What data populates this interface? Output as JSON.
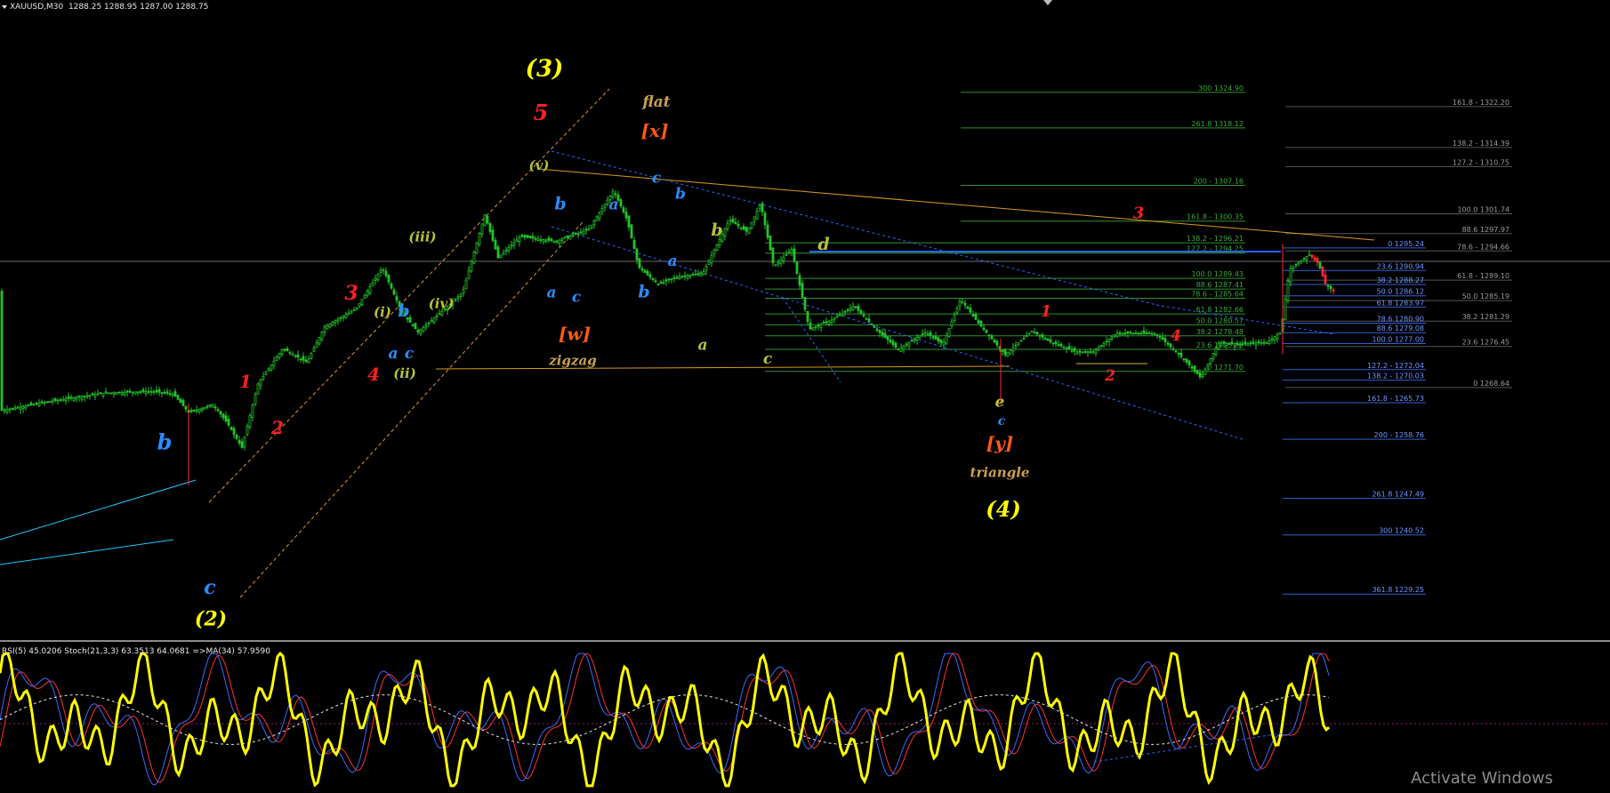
{
  "header": {
    "symbol": "XAUUSD,M30",
    "ohlc": "1288.25 1288.95 1287.00 1288.75"
  },
  "oscillator_header": "RSI(5) 45.0206  Stoch(21,3,3) 63.3513 64.0681  =>MA(34) 57.9590",
  "watermark": "Activate Windows",
  "colors": {
    "background": "#000000",
    "candle": "#22c22a",
    "candle_bear": "#ff2a2a",
    "fib_green": "#2f8f2f",
    "fib_blue": "#2f5fd0",
    "trendline_orange": "#d99a1b",
    "trendline_blue": "#2a63ff",
    "rsi": "#ffff00"
  },
  "chart_data": [
    {
      "type": "candlestick",
      "title": "XAUUSD,M30",
      "ylim": [
        1222,
        1334
      ],
      "price_path": [
        [
          0,
          1264.2
        ],
        [
          60,
          1266.1
        ],
        [
          120,
          1267.6
        ],
        [
          170,
          1267.9
        ],
        [
          195,
          1267.4
        ],
        [
          212,
          1263.9
        ],
        [
          240,
          1265.3
        ],
        [
          255,
          1262.0
        ],
        [
          272,
          1257.2
        ],
        [
          290,
          1269.3
        ],
        [
          318,
          1276.1
        ],
        [
          345,
          1273.4
        ],
        [
          365,
          1280.2
        ],
        [
          400,
          1283.6
        ],
        [
          430,
          1291.5
        ],
        [
          452,
          1282.9
        ],
        [
          470,
          1279.2
        ],
        [
          500,
          1283.6
        ],
        [
          520,
          1286.7
        ],
        [
          545,
          1301.6
        ],
        [
          560,
          1293.4
        ],
        [
          585,
          1297.4
        ],
        [
          625,
          1296.5
        ],
        [
          662,
          1298.8
        ],
        [
          690,
          1306.2
        ],
        [
          705,
          1300.6
        ],
        [
          718,
          1291.6
        ],
        [
          740,
          1288.3
        ],
        [
          760,
          1289.7
        ],
        [
          790,
          1290.4
        ],
        [
          820,
          1300.6
        ],
        [
          840,
          1298.3
        ],
        [
          855,
          1303.7
        ],
        [
          870,
          1291.6
        ],
        [
          890,
          1295.0
        ],
        [
          910,
          1279.7
        ],
        [
          935,
          1281.5
        ],
        [
          960,
          1284.2
        ],
        [
          985,
          1279.7
        ],
        [
          1010,
          1275.9
        ],
        [
          1040,
          1279.2
        ],
        [
          1060,
          1276.9
        ],
        [
          1080,
          1285.5
        ],
        [
          1100,
          1280.9
        ],
        [
          1130,
          1274.9
        ],
        [
          1160,
          1279.4
        ],
        [
          1180,
          1277.4
        ],
        [
          1210,
          1275.4
        ],
        [
          1230,
          1275.5
        ],
        [
          1255,
          1279.0
        ],
        [
          1280,
          1279.0
        ],
        [
          1300,
          1278.9
        ],
        [
          1330,
          1274.2
        ],
        [
          1350,
          1270.5
        ],
        [
          1370,
          1277.1
        ],
        [
          1400,
          1276.9
        ],
        [
          1425,
          1277.3
        ],
        [
          1440,
          1279.2
        ],
        [
          1445,
          1285.5
        ],
        [
          1450,
          1291.2
        ],
        [
          1460,
          1292.5
        ],
        [
          1472,
          1294.0
        ],
        [
          1482,
          1292.3
        ],
        [
          1490,
          1288.5
        ],
        [
          1500,
          1286.8
        ],
        [
          1502,
          1287.0
        ]
      ],
      "fib_levels_upper": [
        {
          "label": "300 1324.90",
          "price": 1324.9
        },
        {
          "label": "261.8 1318.12",
          "price": 1318.12
        },
        {
          "label": "200 - 1307.16",
          "price": 1307.16
        },
        {
          "label": "161.8 - 1300.35",
          "price": 1300.35
        },
        {
          "label": "138.2 - 1296.21",
          "price": 1296.21
        },
        {
          "label": "127.2 - 1294.25",
          "price": 1294.25
        },
        {
          "label": "100.0 1289.43",
          "price": 1289.43
        },
        {
          "label": "88.6 1287.41",
          "price": 1287.41
        },
        {
          "label": "78.6 - 1285.64",
          "price": 1285.64
        },
        {
          "label": "61.8 1282.66",
          "price": 1282.66
        },
        {
          "label": "50.0 1280.57",
          "price": 1280.57
        },
        {
          "label": "38.2 1278.48",
          "price": 1278.48
        },
        {
          "label": "23.6 1275.89",
          "price": 1275.89
        },
        {
          "label": "0 1271.70",
          "price": 1271.7
        }
      ],
      "fib_levels_right": [
        {
          "label": "161.8 - 1322.20",
          "price": 1322.2
        },
        {
          "label": "138.2 - 1314.39",
          "price": 1314.39
        },
        {
          "label": "127.2 - 1310.75",
          "price": 1310.75
        },
        {
          "label": "100.0 1301.74",
          "price": 1301.74
        },
        {
          "label": "88.6 1297.97",
          "price": 1297.97
        },
        {
          "label": "78.6 - 1294.66",
          "price": 1294.66
        },
        {
          "label": "61.8 - 1289.10",
          "price": 1289.1
        },
        {
          "label": "50.0 1285.19",
          "price": 1285.19
        },
        {
          "label": "38.2 1281.29",
          "price": 1281.29
        },
        {
          "label": "23.6 1276.45",
          "price": 1276.45
        },
        {
          "label": "0 1268.64",
          "price": 1268.64
        }
      ],
      "fib_levels_blue": [
        {
          "label": "0 1295.24",
          "price": 1295.24
        },
        {
          "label": "23.6 1290.94",
          "price": 1290.94
        },
        {
          "label": "38.2 1288.27",
          "price": 1288.27
        },
        {
          "label": "50.0 1286.12",
          "price": 1286.12
        },
        {
          "label": "61.8 1283.97",
          "price": 1283.97
        },
        {
          "label": "78.6 1280.90",
          "price": 1280.9
        },
        {
          "label": "88.6 1279.08",
          "price": 1279.08
        },
        {
          "label": "100.0 1277.00",
          "price": 1277.0
        },
        {
          "label": "127.2 - 1272.04",
          "price": 1272.04
        },
        {
          "label": "138.2 - 1270.03",
          "price": 1270.03
        },
        {
          "label": "161.8 - 1265.73",
          "price": 1265.73
        },
        {
          "label": "200 - 1258.76",
          "price": 1258.76
        },
        {
          "label": "261.8 1247.49",
          "price": 1247.49
        },
        {
          "label": "300 1240.52",
          "price": 1240.52
        },
        {
          "label": "361.8 1229.25",
          "price": 1229.25
        }
      ],
      "wave_labels": [
        {
          "text": "(3)",
          "color": "#ffff00",
          "x": 612,
          "price": 1328.0,
          "size": 26
        },
        {
          "text": "5",
          "color": "#ff2020",
          "x": 608,
          "price": 1319.6,
          "size": 24
        },
        {
          "text": "(v)",
          "color": "#b8c23a",
          "x": 606,
          "price": 1310.1,
          "size": 15
        },
        {
          "text": "(iii)",
          "color": "#b8c23a",
          "x": 475,
          "price": 1296.5,
          "size": 15
        },
        {
          "text": "3",
          "color": "#ff2020",
          "x": 395,
          "price": 1285.4,
          "size": 22
        },
        {
          "text": "(i)",
          "color": "#b8c23a",
          "x": 430,
          "price": 1282.2,
          "size": 15
        },
        {
          "text": "b",
          "color": "#2a8cff",
          "x": 454,
          "price": 1282.2,
          "size": 19
        },
        {
          "text": "(iv)",
          "color": "#b8c23a",
          "x": 496,
          "price": 1283.8,
          "size": 15
        },
        {
          "text": "1",
          "color": "#ff2020",
          "x": 276,
          "price": 1268.6,
          "size": 20
        },
        {
          "text": "4",
          "color": "#ff2020",
          "x": 420,
          "price": 1270.0,
          "size": 20
        },
        {
          "text": "(ii)",
          "color": "#b8c23a",
          "x": 455,
          "price": 1270.5,
          "size": 15
        },
        {
          "text": "a",
          "color": "#2a8cff",
          "x": 442,
          "price": 1274.2,
          "size": 17
        },
        {
          "text": "c",
          "color": "#2a8cff",
          "x": 460,
          "price": 1274.2,
          "size": 17
        },
        {
          "text": "2",
          "color": "#ff2020",
          "x": 312,
          "price": 1259.8,
          "size": 20
        },
        {
          "text": "b",
          "color": "#2a8cff",
          "x": 185,
          "price": 1256.8,
          "size": 24
        },
        {
          "text": "c",
          "color": "#2a8cff",
          "x": 236,
          "price": 1229.3,
          "size": 22
        },
        {
          "text": "(2)",
          "color": "#ffff00",
          "x": 237,
          "price": 1223.3,
          "size": 22
        },
        {
          "text": "flat",
          "color": "#c8a050",
          "x": 738,
          "price": 1322.2,
          "size": 17
        },
        {
          "text": "[x]",
          "color": "#ff5a14",
          "x": 736,
          "price": 1316.4,
          "size": 20
        },
        {
          "text": "c",
          "color": "#2a8cff",
          "x": 738,
          "price": 1307.7,
          "size": 17
        },
        {
          "text": "b",
          "color": "#2a8cff",
          "x": 630,
          "price": 1302.6,
          "size": 19
        },
        {
          "text": "a",
          "color": "#2a8cff",
          "x": 690,
          "price": 1302.6,
          "size": 17
        },
        {
          "text": "b",
          "color": "#2a8cff",
          "x": 765,
          "price": 1304.6,
          "size": 17
        },
        {
          "text": "b",
          "color": "#b8c23a",
          "x": 806,
          "price": 1297.6,
          "size": 19
        },
        {
          "text": "a",
          "color": "#2a8cff",
          "x": 756,
          "price": 1291.8,
          "size": 17
        },
        {
          "text": "a",
          "color": "#2a8cff",
          "x": 620,
          "price": 1285.8,
          "size": 17
        },
        {
          "text": "c",
          "color": "#2a8cff",
          "x": 648,
          "price": 1285.0,
          "size": 17
        },
        {
          "text": "b",
          "color": "#2a8cff",
          "x": 724,
          "price": 1285.8,
          "size": 19
        },
        {
          "text": "[w]",
          "color": "#ff5a14",
          "x": 646,
          "price": 1277.7,
          "size": 20
        },
        {
          "text": "zigzag",
          "color": "#c8a050",
          "x": 644,
          "price": 1272.9,
          "size": 15
        },
        {
          "text": "d",
          "color": "#b8c23a",
          "x": 926,
          "price": 1294.9,
          "size": 19
        },
        {
          "text": "a",
          "color": "#b8c23a",
          "x": 790,
          "price": 1275.8,
          "size": 17
        },
        {
          "text": "c",
          "color": "#b8c23a",
          "x": 863,
          "price": 1273.2,
          "size": 17
        },
        {
          "text": "1",
          "color": "#ff2020",
          "x": 1176,
          "price": 1282.2,
          "size": 18
        },
        {
          "text": "e",
          "color": "#b8c23a",
          "x": 1124,
          "price": 1265.0,
          "size": 17
        },
        {
          "text": "c",
          "color": "#2a8cff",
          "x": 1126,
          "price": 1261.5,
          "size": 14
        },
        {
          "text": "[y]",
          "color": "#ff5a14",
          "x": 1124,
          "price": 1256.8,
          "size": 20
        },
        {
          "text": "triangle",
          "color": "#c8a050",
          "x": 1124,
          "price": 1251.6,
          "size": 15
        },
        {
          "text": "(4)",
          "color": "#ffff00",
          "x": 1128,
          "price": 1244.0,
          "size": 24
        },
        {
          "text": "3",
          "color": "#ff2020",
          "x": 1280,
          "price": 1300.9,
          "size": 18
        },
        {
          "text": "4",
          "color": "#ff2020",
          "x": 1322,
          "price": 1277.6,
          "size": 17
        },
        {
          "text": "2",
          "color": "#ff2020",
          "x": 1248,
          "price": 1270.0,
          "size": 17
        }
      ]
    },
    {
      "type": "line",
      "title": "RSI(5) 45.0206  Stoch(21,3,3) 63.3513 64.0681  =>MA(34) 57.9590",
      "ylim": [
        0,
        100
      ],
      "series": [
        {
          "name": "RSI(5)",
          "last": 45.0206
        },
        {
          "name": "Stoch(21,3,3)",
          "last": 63.3513
        },
        {
          "name": "Signal",
          "last": 64.0681
        },
        {
          "name": "MA(34)",
          "last": 57.959
        }
      ]
    }
  ]
}
